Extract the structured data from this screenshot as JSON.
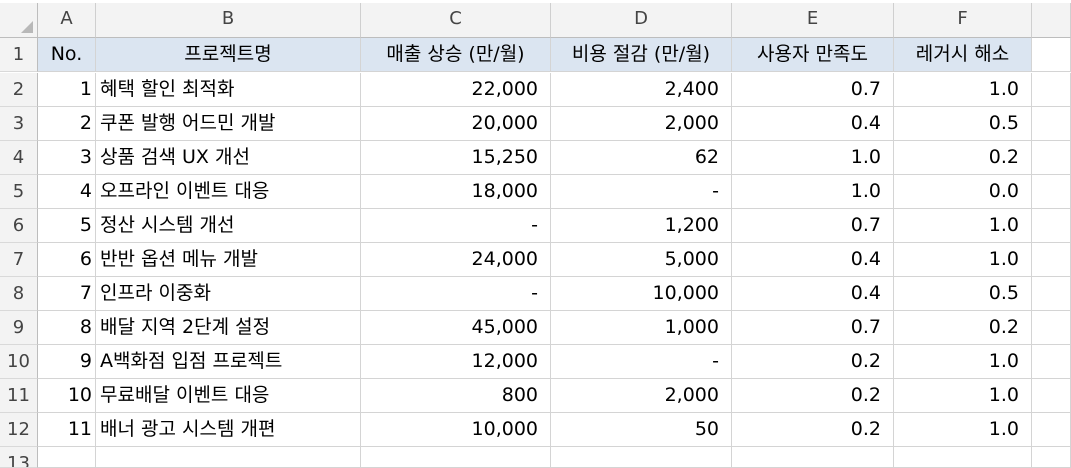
{
  "columns": [
    "A",
    "B",
    "C",
    "D",
    "E",
    "F"
  ],
  "rows": [
    "1",
    "2",
    "3",
    "4",
    "5",
    "6",
    "7",
    "8",
    "9",
    "10",
    "11",
    "12",
    "13"
  ],
  "header": {
    "no": "No.",
    "project": "프로젝트명",
    "revenue": "매출 상승 (만/월)",
    "cost": "비용 절감 (만/월)",
    "satisfaction": "사용자 만족도",
    "legacy": "레거시 해소"
  },
  "table": [
    {
      "no": "1",
      "project": "혜택 할인 최적화",
      "revenue": "22,000",
      "cost": "2,400",
      "satisfaction": "0.7",
      "legacy": "1.0"
    },
    {
      "no": "2",
      "project": "쿠폰 발행 어드민 개발",
      "revenue": "20,000",
      "cost": "2,000",
      "satisfaction": "0.4",
      "legacy": "0.5"
    },
    {
      "no": "3",
      "project": "상품 검색 UX 개선",
      "revenue": "15,250",
      "cost": "62",
      "satisfaction": "1.0",
      "legacy": "0.2"
    },
    {
      "no": "4",
      "project": "오프라인 이벤트 대응",
      "revenue": "18,000",
      "cost": "-",
      "satisfaction": "1.0",
      "legacy": "0.0"
    },
    {
      "no": "5",
      "project": "정산 시스템 개선",
      "revenue": "-",
      "cost": "1,200",
      "satisfaction": "0.7",
      "legacy": "1.0"
    },
    {
      "no": "6",
      "project": "반반 옵션 메뉴 개발",
      "revenue": "24,000",
      "cost": "5,000",
      "satisfaction": "0.4",
      "legacy": "1.0"
    },
    {
      "no": "7",
      "project": "인프라 이중화",
      "revenue": "-",
      "cost": "10,000",
      "satisfaction": "0.4",
      "legacy": "0.5"
    },
    {
      "no": "8",
      "project": "배달 지역 2단계 설정",
      "revenue": "45,000",
      "cost": "1,000",
      "satisfaction": "0.7",
      "legacy": "0.2"
    },
    {
      "no": "9",
      "project": "A백화점 입점 프로젝트",
      "revenue": "12,000",
      "cost": "-",
      "satisfaction": "0.2",
      "legacy": "1.0"
    },
    {
      "no": "10",
      "project": "무료배달 이벤트 대응",
      "revenue": "800",
      "cost": "2,000",
      "satisfaction": "0.2",
      "legacy": "1.0"
    },
    {
      "no": "11",
      "project": "배너 광고 시스템 개편",
      "revenue": "10,000",
      "cost": "50",
      "satisfaction": "0.2",
      "legacy": "1.0"
    }
  ]
}
